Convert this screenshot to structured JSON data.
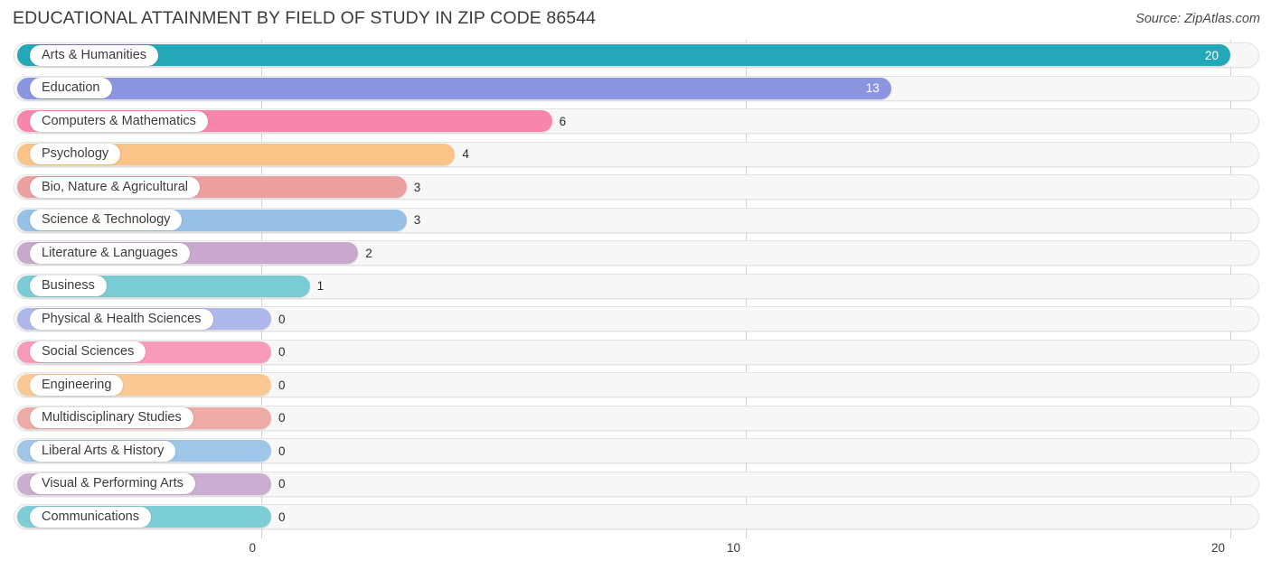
{
  "header": {
    "title": "EDUCATIONAL ATTAINMENT BY FIELD OF STUDY IN ZIP CODE 86544",
    "source": "Source: ZipAtlas.com"
  },
  "chart_data": {
    "type": "bar",
    "orientation": "horizontal",
    "title": "EDUCATIONAL ATTAINMENT BY FIELD OF STUDY IN ZIP CODE 86544",
    "xlabel": "",
    "ylabel": "",
    "xlim": [
      0,
      20
    ],
    "grid": true,
    "legend": "none",
    "xticks": [
      "0",
      "10",
      "20"
    ],
    "xtick_values": [
      0,
      10,
      20
    ],
    "categories": [
      "Arts & Humanities",
      "Education",
      "Computers & Mathematics",
      "Psychology",
      "Bio, Nature & Agricultural",
      "Science & Technology",
      "Literature & Languages",
      "Business",
      "Physical & Health Sciences",
      "Social Sciences",
      "Engineering",
      "Multidisciplinary Studies",
      "Liberal Arts & History",
      "Visual & Performing Arts",
      "Communications"
    ],
    "values": [
      20,
      13,
      6,
      4,
      3,
      3,
      2,
      1,
      0,
      0,
      0,
      0,
      0,
      0,
      0
    ],
    "value_labels": [
      "20",
      "13",
      "6",
      "4",
      "3",
      "3",
      "2",
      "1",
      "0",
      "0",
      "0",
      "0",
      "0",
      "0",
      "0"
    ],
    "colors": [
      "#22a8b8",
      "#8b95e0",
      "#f885ab",
      "#fac388",
      "#eb9f9f",
      "#96c0e6",
      "#c9a8cd",
      "#7bcbd4",
      "#aeb8ea",
      "#f89bba",
      "#fbc893",
      "#eeaaa6",
      "#9fc6e9",
      "#ccadd2",
      "#7ccdd6"
    ]
  }
}
